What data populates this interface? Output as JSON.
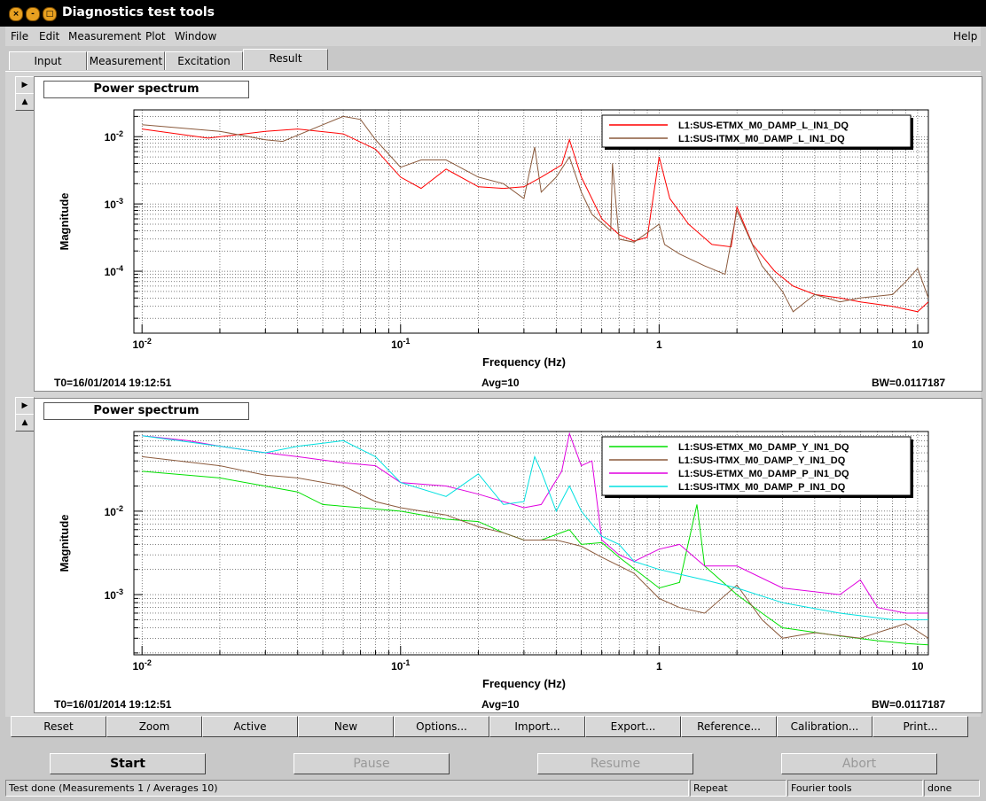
{
  "window": {
    "title": "Diagnostics test tools"
  },
  "menu": {
    "file": "File",
    "edit": "Edit",
    "measurement": "Measurement",
    "plot": "Plot",
    "window": "Window",
    "help": "Help"
  },
  "tabs": [
    "Input",
    "Measurement",
    "Excitation",
    "Result"
  ],
  "active_tab": "Result",
  "colors": {
    "red": "#ff0000",
    "brown": "#8b5a3c",
    "green": "#00e000",
    "magenta": "#e000e0",
    "cyan": "#00e0e0",
    "bg": "#d4d4d4"
  },
  "icons": [
    "close-icon",
    "minimize-icon",
    "maximize-icon",
    "arrow-right-icon",
    "arrow-up-icon"
  ],
  "plots": [
    {
      "title": "Power spectrum",
      "t0": "T0=16/01/2014 19:12:51",
      "avg": "Avg=10",
      "bw": "BW=0.0117187",
      "legend": [
        "L1:SUS-ETMX_M0_DAMP_L_IN1_DQ",
        "L1:SUS-ITMX_M0_DAMP_L_IN1_DQ"
      ]
    },
    {
      "title": "Power spectrum",
      "t0": "T0=16/01/2014 19:12:51",
      "avg": "Avg=10",
      "bw": "BW=0.0117187",
      "legend": [
        "L1:SUS-ETMX_M0_DAMP_Y_IN1_DQ",
        "L1:SUS-ITMX_M0_DAMP_Y_IN1_DQ",
        "L1:SUS-ETMX_M0_DAMP_P_IN1_DQ",
        "L1:SUS-ITMX_M0_DAMP_P_IN1_DQ"
      ]
    }
  ],
  "chart_data": [
    {
      "type": "line",
      "title": "Power spectrum",
      "xlabel": "Frequency (Hz)",
      "ylabel": "Magnitude",
      "xscale": "log",
      "yscale": "log",
      "xlim": [
        0.0093,
        11
      ],
      "ylim": [
        1.2e-05,
        0.025
      ],
      "x_ticks": [
        "10-2",
        "10-1",
        "1",
        "10"
      ],
      "y_ticks": [
        "10-4",
        "10-3",
        "10-2"
      ],
      "grid": true,
      "legend_position": "top-right",
      "series": [
        {
          "name": "L1:SUS-ETMX_M0_DAMP_L_IN1_DQ",
          "color": "#ff0000",
          "x": [
            0.01,
            0.018,
            0.03,
            0.04,
            0.06,
            0.08,
            0.1,
            0.12,
            0.15,
            0.2,
            0.25,
            0.3,
            0.35,
            0.42,
            0.45,
            0.5,
            0.6,
            0.7,
            0.8,
            0.9,
            1.0,
            1.1,
            1.3,
            1.6,
            1.9,
            2.0,
            2.3,
            2.8,
            3.3,
            4.0,
            5.0,
            6.0,
            8.0,
            10.0,
            11.0
          ],
          "y": [
            0.013,
            0.0095,
            0.012,
            0.013,
            0.011,
            0.0065,
            0.0025,
            0.0017,
            0.0033,
            0.0018,
            0.0017,
            0.0018,
            0.0025,
            0.0038,
            0.009,
            0.0025,
            0.0006,
            0.00035,
            0.00028,
            0.00032,
            0.005,
            0.0012,
            0.0005,
            0.00025,
            0.00023,
            0.0009,
            0.00025,
            0.0001,
            6e-05,
            4.5e-05,
            4e-05,
            3.5e-05,
            3e-05,
            2.5e-05,
            3.5e-05
          ]
        },
        {
          "name": "L1:SUS-ITMX_M0_DAMP_L_IN1_DQ",
          "color": "#8b5a3c",
          "x": [
            0.01,
            0.02,
            0.03,
            0.035,
            0.05,
            0.06,
            0.07,
            0.08,
            0.1,
            0.12,
            0.15,
            0.2,
            0.25,
            0.3,
            0.33,
            0.35,
            0.4,
            0.45,
            0.5,
            0.55,
            0.65,
            0.66,
            0.7,
            0.8,
            1.0,
            1.05,
            1.2,
            1.5,
            1.8,
            2.0,
            2.5,
            3.0,
            3.3,
            4.0,
            5.0,
            6.0,
            8.0,
            9.0,
            10.0,
            11.0
          ],
          "y": [
            0.015,
            0.012,
            0.009,
            0.0085,
            0.015,
            0.02,
            0.018,
            0.009,
            0.0035,
            0.0045,
            0.0045,
            0.0025,
            0.002,
            0.0012,
            0.007,
            0.0015,
            0.0025,
            0.005,
            0.0015,
            0.0007,
            0.0004,
            0.004,
            0.0003,
            0.00027,
            0.0005,
            0.00025,
            0.00018,
            0.00012,
            9e-05,
            0.0008,
            0.00012,
            5e-05,
            2.5e-05,
            4.5e-05,
            3.5e-05,
            4e-05,
            4.5e-05,
            7e-05,
            0.00011,
            4e-05
          ]
        }
      ]
    },
    {
      "type": "line",
      "title": "Power spectrum",
      "xlabel": "Frequency (Hz)",
      "ylabel": "Magnitude",
      "xscale": "log",
      "yscale": "log",
      "xlim": [
        0.0093,
        11
      ],
      "ylim": [
        0.00019,
        0.09
      ],
      "x_ticks": [
        "10-2",
        "10-1",
        "1",
        "10"
      ],
      "y_ticks": [
        "10-3",
        "10-2"
      ],
      "grid": true,
      "legend_position": "top-right",
      "series": [
        {
          "name": "L1:SUS-ETMX_M0_DAMP_Y_IN1_DQ",
          "color": "#00e000",
          "x": [
            0.01,
            0.02,
            0.04,
            0.05,
            0.07,
            0.1,
            0.15,
            0.2,
            0.25,
            0.3,
            0.35,
            0.45,
            0.5,
            0.6,
            0.7,
            1.0,
            1.2,
            1.4,
            1.5,
            2.0,
            2.5,
            3.0,
            5.0,
            7.0,
            9.0,
            11.0
          ],
          "y": [
            0.03,
            0.025,
            0.017,
            0.012,
            0.011,
            0.01,
            0.008,
            0.0075,
            0.0055,
            0.0045,
            0.0045,
            0.006,
            0.004,
            0.0042,
            0.0028,
            0.0012,
            0.0014,
            0.012,
            0.0022,
            0.001,
            0.0006,
            0.0004,
            0.00032,
            0.00028,
            0.00026,
            0.00025
          ]
        },
        {
          "name": "L1:SUS-ITMX_M0_DAMP_Y_IN1_DQ",
          "color": "#8b5a3c",
          "x": [
            0.01,
            0.02,
            0.03,
            0.04,
            0.06,
            0.08,
            0.1,
            0.15,
            0.2,
            0.25,
            0.3,
            0.4,
            0.5,
            0.6,
            0.8,
            1.0,
            1.2,
            1.5,
            2.0,
            2.5,
            3.0,
            4.0,
            6.0,
            9.0,
            11.0
          ],
          "y": [
            0.045,
            0.035,
            0.027,
            0.025,
            0.02,
            0.013,
            0.011,
            0.009,
            0.0065,
            0.0055,
            0.0045,
            0.0045,
            0.0038,
            0.0028,
            0.0018,
            0.0009,
            0.0007,
            0.0006,
            0.0013,
            0.0005,
            0.0003,
            0.00035,
            0.0003,
            0.00045,
            0.0003
          ]
        },
        {
          "name": "L1:SUS-ETMX_M0_DAMP_P_IN1_DQ",
          "color": "#e000e0",
          "x": [
            0.01,
            0.015,
            0.02,
            0.03,
            0.04,
            0.06,
            0.08,
            0.1,
            0.15,
            0.2,
            0.3,
            0.35,
            0.42,
            0.45,
            0.5,
            0.55,
            0.6,
            0.7,
            0.8,
            1.0,
            1.2,
            1.5,
            2.0,
            3.0,
            5.0,
            6.0,
            7.0,
            9.0,
            11.0
          ],
          "y": [
            0.08,
            0.07,
            0.06,
            0.05,
            0.045,
            0.038,
            0.035,
            0.022,
            0.02,
            0.016,
            0.011,
            0.012,
            0.03,
            0.085,
            0.035,
            0.04,
            0.0045,
            0.003,
            0.0025,
            0.0035,
            0.004,
            0.0022,
            0.0022,
            0.0012,
            0.001,
            0.0015,
            0.0007,
            0.0006,
            0.0006
          ]
        },
        {
          "name": "L1:SUS-ITMX_M0_DAMP_P_IN1_DQ",
          "color": "#00e0e0",
          "x": [
            0.01,
            0.02,
            0.03,
            0.04,
            0.05,
            0.06,
            0.08,
            0.1,
            0.15,
            0.2,
            0.25,
            0.3,
            0.33,
            0.35,
            0.4,
            0.45,
            0.5,
            0.6,
            0.7,
            0.8,
            1.0,
            1.5,
            2.0,
            3.0,
            5.0,
            8.0,
            11.0
          ],
          "y": [
            0.08,
            0.06,
            0.05,
            0.06,
            0.065,
            0.07,
            0.045,
            0.022,
            0.015,
            0.028,
            0.012,
            0.013,
            0.045,
            0.03,
            0.01,
            0.02,
            0.01,
            0.005,
            0.004,
            0.0025,
            0.002,
            0.0015,
            0.0012,
            0.0008,
            0.0006,
            0.0005,
            0.0005
          ]
        }
      ]
    }
  ],
  "buttons": [
    "Reset",
    "Zoom",
    "Active",
    "New",
    "Options...",
    "Import...",
    "Export...",
    "Reference...",
    "Calibration...",
    "Print..."
  ],
  "controls": {
    "start": "Start",
    "pause": "Pause",
    "resume": "Resume",
    "abort": "Abort"
  },
  "status": {
    "message": "Test done (Measurements 1 / Averages 10)",
    "mode": "Repeat",
    "tool": "Fourier tools",
    "state": "done"
  }
}
